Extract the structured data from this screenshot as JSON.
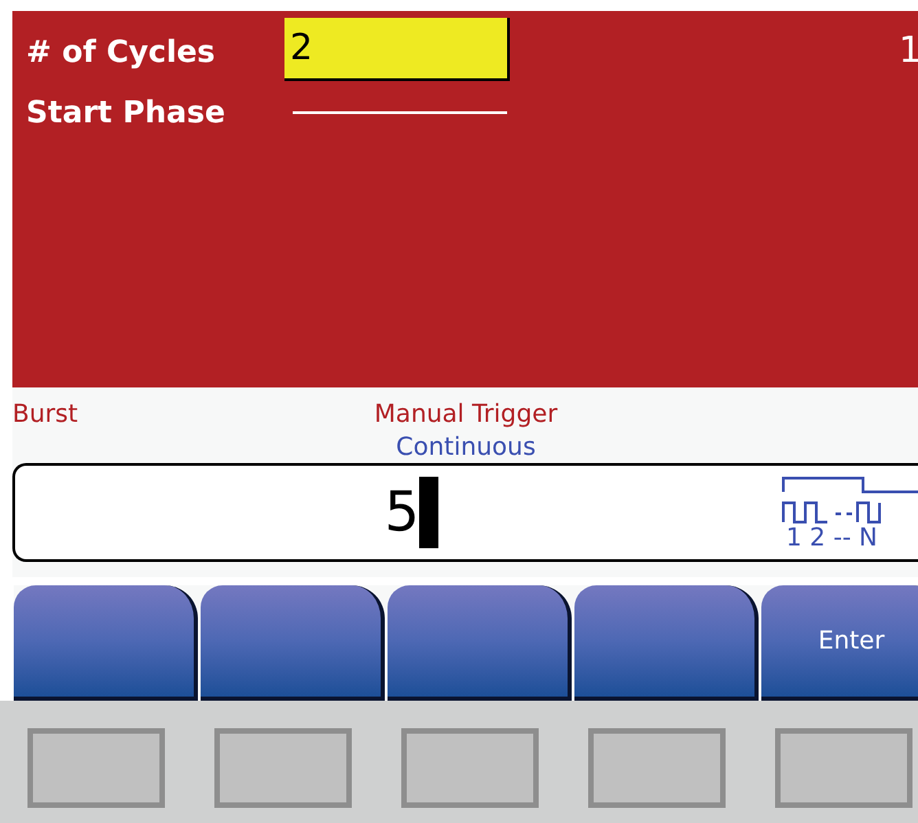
{
  "parameters": [
    {
      "label": "# of Cycles",
      "value": "2",
      "kind": "field",
      "selected": true
    },
    {
      "label": "Start Phase",
      "kind": "blank",
      "selected": false
    }
  ],
  "corner_text": "1",
  "status": {
    "mode": "Burst",
    "trigger": "Manual Trigger",
    "trigger_mode": "Continuous"
  },
  "entry": {
    "value": "5",
    "burst_labels": "1 2 -- N"
  },
  "softkeys": [
    {
      "kind": "blank"
    },
    {
      "kind": "blank"
    },
    {
      "kind": "blank"
    },
    {
      "kind": "blank"
    },
    {
      "kind": "label",
      "label": "Enter"
    }
  ]
}
